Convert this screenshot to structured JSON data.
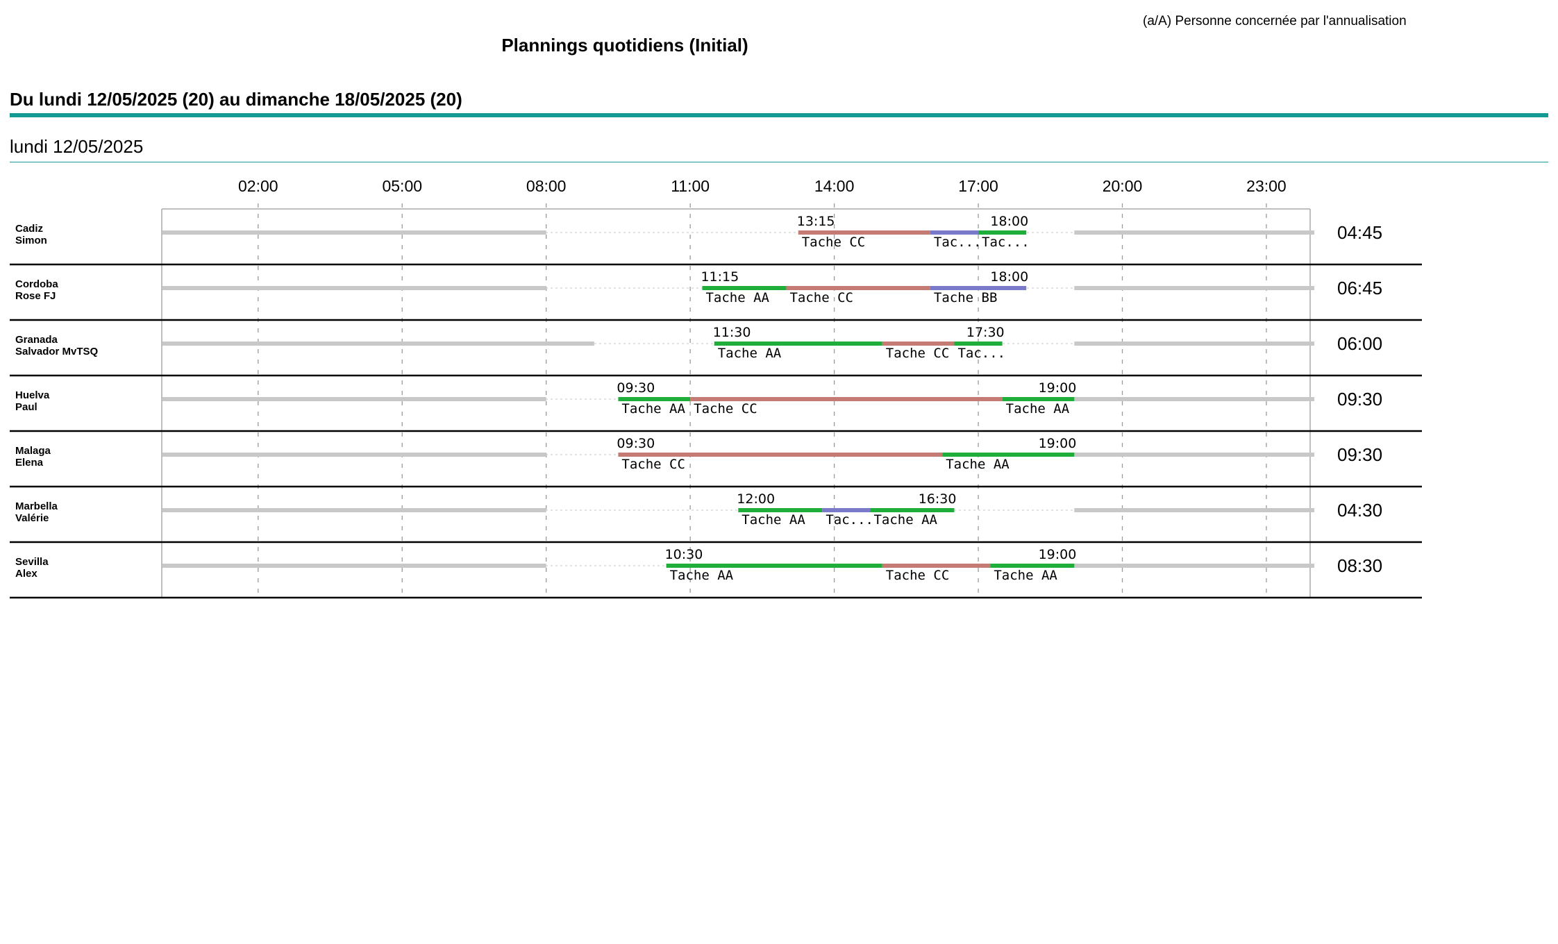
{
  "header": {
    "legend_note": "(a/A) Personne concernée par l'annualisation",
    "title": "Plannings quotidiens (Initial)",
    "period": "Du lundi 12/05/2025 (20) au dimanche 18/05/2025 (20)",
    "day": "lundi 12/05/2025"
  },
  "colors": {
    "accent": "#149a94",
    "tache_aa": "#1fae3a",
    "tache_cc": "#c47b73",
    "tache_bb": "#7a7ac8",
    "availability": "#c8c8c8",
    "grid": "#9a9a9a"
  },
  "chart_data": {
    "type": "gantt",
    "x_axis_ticks": [
      "02:00",
      "05:00",
      "08:00",
      "11:00",
      "14:00",
      "17:00",
      "20:00",
      "23:00"
    ],
    "rows": [
      {
        "name": [
          "Cadiz",
          "Simon"
        ],
        "start_label": "13:15",
        "end_label": "18:00",
        "total": "04:45",
        "availability": [
          [
            0,
            8
          ],
          [
            19.0,
            24
          ]
        ],
        "segments": [
          {
            "task": "Tache CC",
            "label": "Tache CC",
            "start": 13.25,
            "end": 16.0
          },
          {
            "task": "Tache BB",
            "label": "Tac...",
            "start": 16.0,
            "end": 17.0
          },
          {
            "task": "Tache AA",
            "label": "Tac...",
            "start": 17.0,
            "end": 18.0
          }
        ]
      },
      {
        "name": [
          "Cordoba",
          "Rose FJ"
        ],
        "start_label": "11:15",
        "end_label": "18:00",
        "total": "06:45",
        "availability": [
          [
            0,
            8
          ],
          [
            19.0,
            24
          ]
        ],
        "segments": [
          {
            "task": "Tache AA",
            "label": "Tache AA",
            "start": 11.25,
            "end": 13.0
          },
          {
            "task": "Tache CC",
            "label": "Tache CC",
            "start": 13.0,
            "end": 16.0
          },
          {
            "task": "Tache BB",
            "label": "Tache BB",
            "start": 16.0,
            "end": 18.0
          }
        ]
      },
      {
        "name": [
          "Granada",
          "Salvador MvTSQ"
        ],
        "start_label": "11:30",
        "end_label": "17:30",
        "total": "06:00",
        "availability": [
          [
            0,
            9
          ],
          [
            19.0,
            24
          ]
        ],
        "segments": [
          {
            "task": "Tache AA",
            "label": "Tache AA",
            "start": 11.5,
            "end": 15.0
          },
          {
            "task": "Tache CC",
            "label": "Tache CC",
            "start": 15.0,
            "end": 16.5
          },
          {
            "task": "Tache AA",
            "label": "Tac...",
            "start": 16.5,
            "end": 17.5
          }
        ]
      },
      {
        "name": [
          "Huelva",
          "Paul"
        ],
        "start_label": "09:30",
        "end_label": "19:00",
        "total": "09:30",
        "availability": [
          [
            0,
            8
          ],
          [
            19.0,
            24
          ]
        ],
        "segments": [
          {
            "task": "Tache AA",
            "label": "Tache AA",
            "start": 9.5,
            "end": 11.0
          },
          {
            "task": "Tache CC",
            "label": "Tache CC",
            "start": 11.0,
            "end": 17.5
          },
          {
            "task": "Tache AA",
            "label": "Tache AA",
            "start": 17.5,
            "end": 19.0
          }
        ]
      },
      {
        "name": [
          "Malaga",
          "Elena"
        ],
        "start_label": "09:30",
        "end_label": "19:00",
        "total": "09:30",
        "availability": [
          [
            0,
            8
          ],
          [
            19.0,
            24
          ]
        ],
        "segments": [
          {
            "task": "Tache CC",
            "label": "Tache CC",
            "start": 9.5,
            "end": 16.25
          },
          {
            "task": "Tache AA",
            "label": "Tache AA",
            "start": 16.25,
            "end": 19.0
          }
        ]
      },
      {
        "name": [
          "Marbella",
          "Valérie"
        ],
        "start_label": "12:00",
        "end_label": "16:30",
        "total": "04:30",
        "availability": [
          [
            0,
            8
          ],
          [
            19.0,
            24
          ]
        ],
        "segments": [
          {
            "task": "Tache AA",
            "label": "Tache AA",
            "start": 12.0,
            "end": 13.75
          },
          {
            "task": "Tache BB",
            "label": "Tac...",
            "start": 13.75,
            "end": 14.75
          },
          {
            "task": "Tache AA",
            "label": "Tache AA",
            "start": 14.75,
            "end": 16.5
          }
        ]
      },
      {
        "name": [
          "Sevilla",
          "Alex"
        ],
        "start_label": "10:30",
        "end_label": "19:00",
        "total": "08:30",
        "availability": [
          [
            0,
            8
          ],
          [
            19.0,
            24
          ]
        ],
        "segments": [
          {
            "task": "Tache AA",
            "label": "Tache AA",
            "start": 10.5,
            "end": 15.0
          },
          {
            "task": "Tache CC",
            "label": "Tache CC",
            "start": 15.0,
            "end": 17.25
          },
          {
            "task": "Tache AA",
            "label": "Tache AA",
            "start": 17.25,
            "end": 19.0
          }
        ]
      }
    ]
  }
}
